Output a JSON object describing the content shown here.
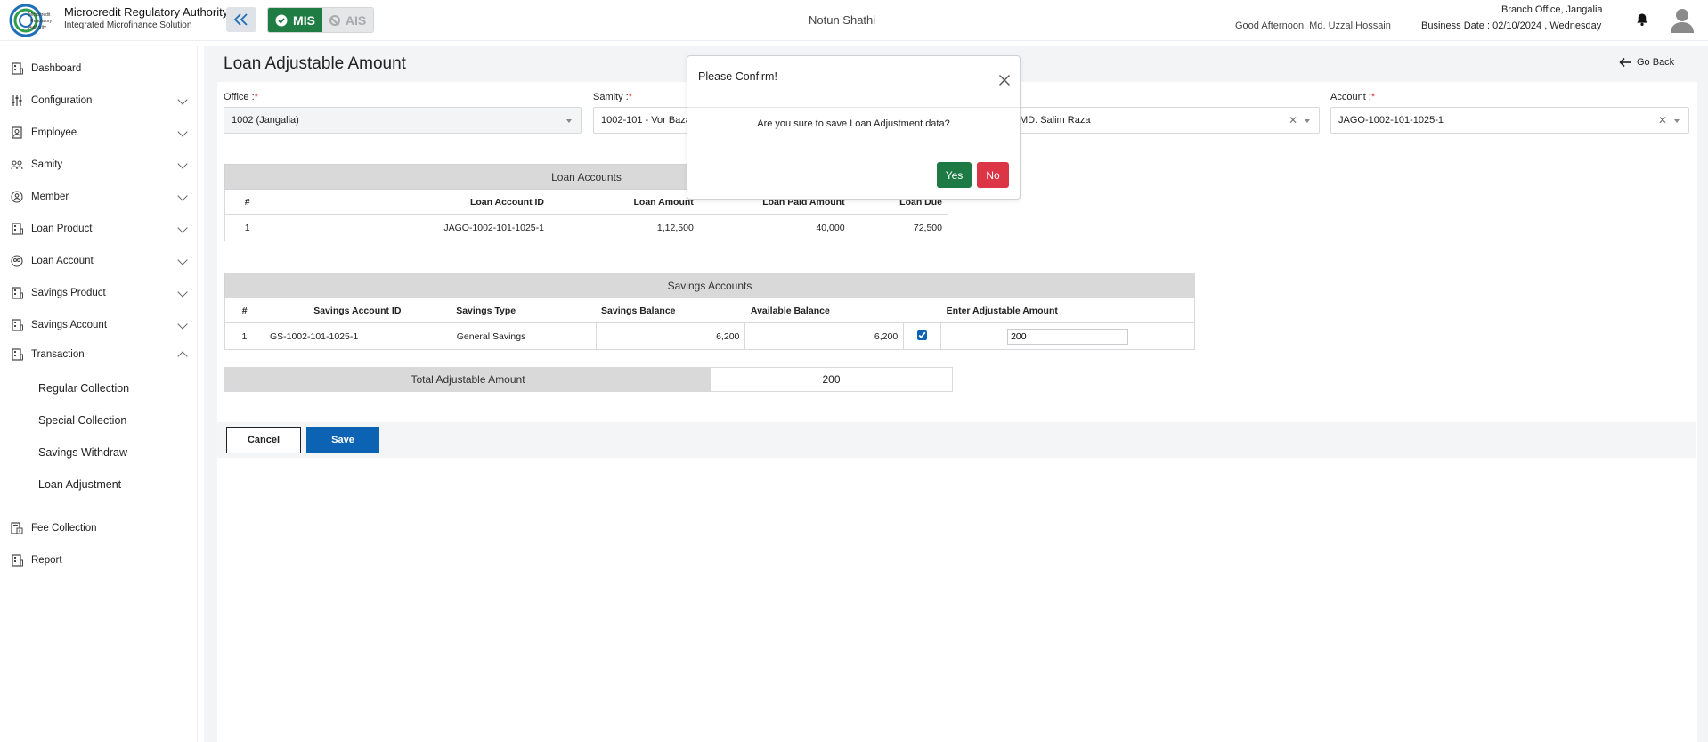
{
  "header": {
    "brand_title": "Microcredit Regulatory Authority",
    "brand_subtitle": "Integrated Microfinance Solution",
    "logo_text": [
      "Microcredit",
      "Regulatory",
      "Authority"
    ],
    "mode_mis": "MIS",
    "mode_ais": "AIS",
    "org_name": "Notun Shathi",
    "greeting": "Good Afternoon, Md. Uzzal Hossain",
    "branch": "Branch Office, Jangalia",
    "business_date": "Business Date : 02/10/2024 , Wednesday"
  },
  "sidebar": {
    "items": [
      {
        "label": "Dashboard",
        "icon": "building-icon"
      },
      {
        "label": "Configuration",
        "icon": "sliders-icon"
      },
      {
        "label": "Employee",
        "icon": "user-icon"
      },
      {
        "label": "Samity",
        "icon": "group-icon"
      },
      {
        "label": "Member",
        "icon": "members-icon"
      },
      {
        "label": "Loan Product",
        "icon": "building-icon"
      },
      {
        "label": "Loan Account",
        "icon": "group-icon"
      },
      {
        "label": "Savings Product",
        "icon": "building-icon"
      },
      {
        "label": "Savings Account",
        "icon": "building-icon"
      },
      {
        "label": "Transaction",
        "icon": "building-icon"
      }
    ],
    "transaction_sub": [
      "Regular Collection",
      "Special Collection",
      "Savings Withdraw",
      "Loan Adjustment"
    ],
    "fee_collection": "Fee Collection",
    "report": "Report"
  },
  "page": {
    "title": "Loan Adjustable Amount",
    "go_back": "Go Back"
  },
  "filters": {
    "office_label": "Office :",
    "office_value": "1002 (Jangalia)",
    "samity_label": "Samity :",
    "samity_value": "1002-101 - Vor Bazar",
    "member_value": "MD. Salim Raza",
    "account_label": "Account :",
    "account_value": "JAGO-1002-101-1025-1",
    "required_mark": "*"
  },
  "loan_accounts": {
    "title": "Loan Accounts",
    "headers": [
      "#",
      "Loan Account ID",
      "Loan Amount",
      "Loan Paid Amount",
      "Loan Due"
    ],
    "rows": [
      [
        "1",
        "JAGO-1002-101-1025-1",
        "1,12,500",
        "40,000",
        "72,500"
      ]
    ]
  },
  "savings_accounts": {
    "title": "Savings Accounts",
    "headers": [
      "#",
      "Savings Account ID",
      "Savings Type",
      "Savings Balance",
      "Available Balance",
      "",
      "Enter Adjustable Amount"
    ],
    "rows": [
      [
        "1",
        "GS-1002-101-1025-1",
        "General Savings",
        "6,200",
        "6,200"
      ]
    ],
    "adjustable_amount": "200",
    "checked": true
  },
  "total": {
    "label": "Total Adjustable Amount",
    "value": "200"
  },
  "actions": {
    "cancel": "Cancel",
    "save": "Save"
  },
  "modal": {
    "title": "Please Confirm!",
    "message": "Are you sure to save Loan Adjustment data?",
    "yes": "Yes",
    "no": "No"
  },
  "colors": {
    "primary_blue": "#0c63b4",
    "success_green": "#1e7a45",
    "danger_red": "#dc3545",
    "header_gray": "#d9d9d9"
  }
}
